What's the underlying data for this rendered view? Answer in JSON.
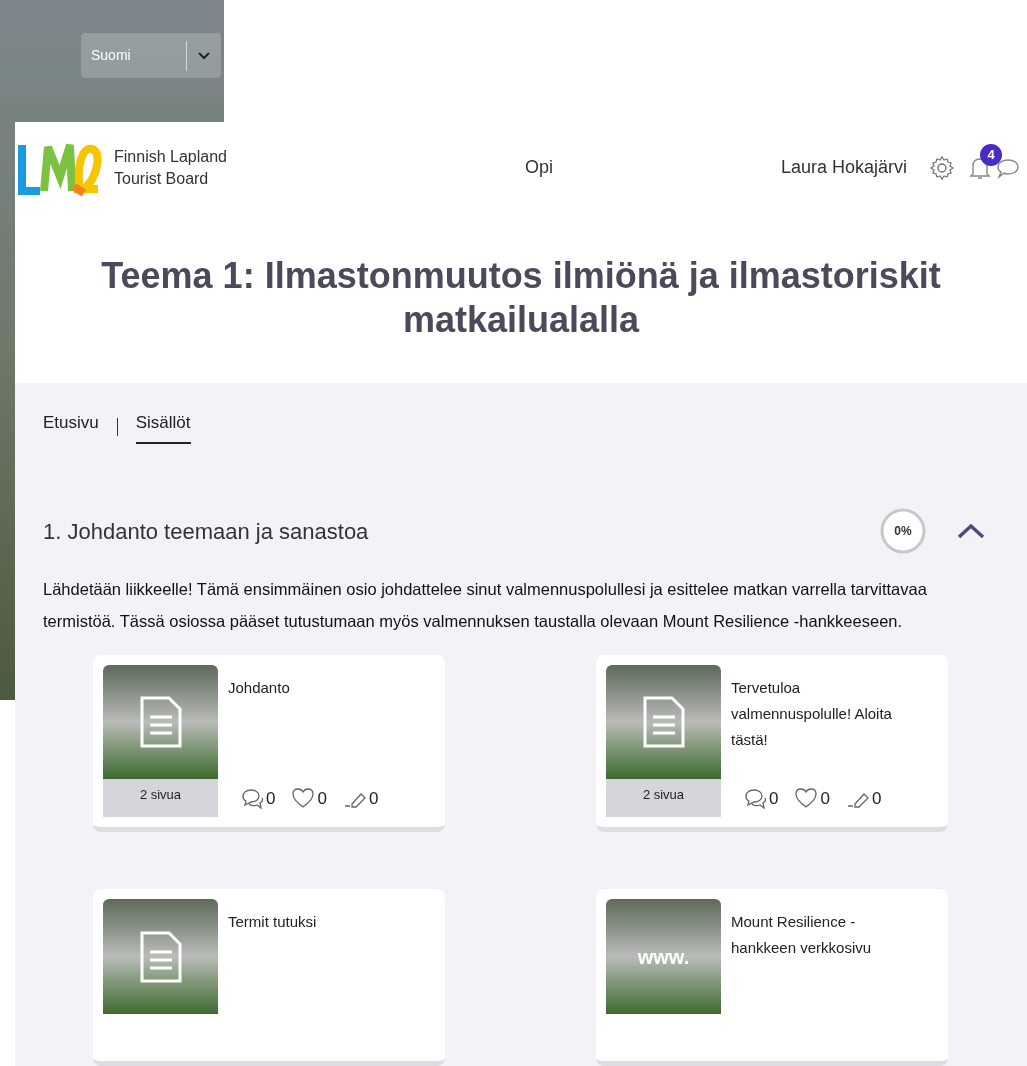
{
  "language_select": {
    "value": "Suomi"
  },
  "header": {
    "logo_text": [
      "Finnish Lapland",
      "Tourist Board"
    ],
    "nav": "Opi",
    "user": "Laura Hokajärvi",
    "notification_count": "4"
  },
  "title": "Teema 1: Ilmastonmuutos ilmiönä ja ilmastoriskit matkailualalla",
  "tabs": [
    {
      "label": "Etusivu",
      "selected": false
    },
    {
      "label": "Sisällöt",
      "selected": true
    }
  ],
  "sections": [
    {
      "heading": "1. Johdanto teemaan ja sanastoa",
      "progress": {
        "text": "0%",
        "level": 0
      },
      "expanded": true,
      "description": "Lähdetään liikkeelle! Tämä ensimmäinen osio johdattelee sinut valmennuspolullesi ja esittelee matkan varrella tarvittavaa termistöä. Tässä osiossa pääset tutustumaan myös valmennuksen taustalla olevaan Mount Resilience -hankkeeseen.",
      "cards": [
        {
          "kind": "document",
          "title": "Johdanto",
          "pages": "2 sivua",
          "comments": "0",
          "likes": "0",
          "edits": "0"
        },
        {
          "kind": "document",
          "title": "Tervetuloa valmennuspolulle! Aloita tästä!",
          "pages": "2 sivua",
          "comments": "0",
          "likes": "0",
          "edits": "0"
        },
        {
          "kind": "document",
          "title": "Termit tutuksi"
        },
        {
          "kind": "web",
          "thumb_label": "www.",
          "title": "Mount Resilience - hankkeen verkkosivu"
        }
      ]
    }
  ]
}
